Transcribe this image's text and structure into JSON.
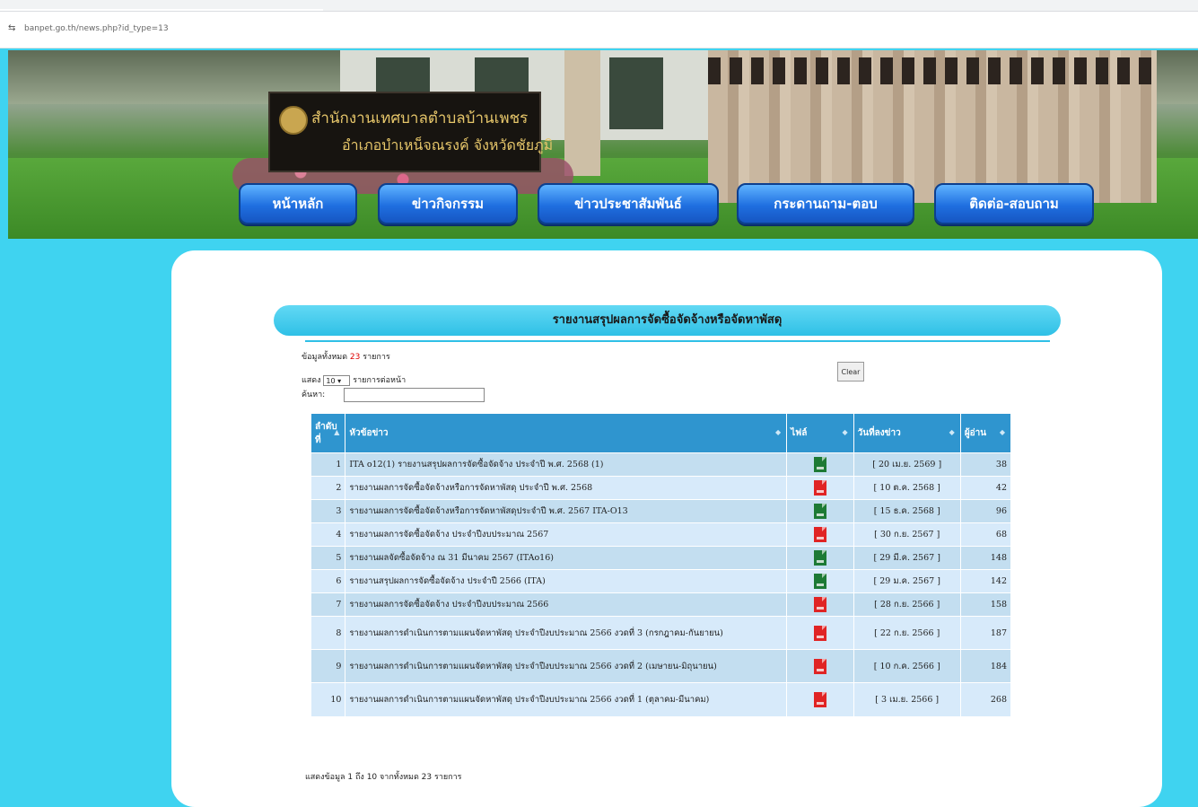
{
  "browser": {
    "url": "banpet.go.th/news.php?id_type=13"
  },
  "banner": {
    "sign_line1": "สำนักงานเทศบาลตำบลบ้านเพชร",
    "sign_line2": "อำเภอบำเหน็จณรงค์ จังหวัดชัยภูมิ"
  },
  "nav": [
    {
      "label": "หน้าหลัก"
    },
    {
      "label": "ข่าวกิจกรรม"
    },
    {
      "label": "ข่าวประชาสัมพันธ์"
    },
    {
      "label": "กระดานถาม-ตอบ"
    },
    {
      "label": "ติดต่อ-สอบถาม"
    }
  ],
  "page": {
    "title": "รายงานสรุปผลการจัดซื้อจัดจ้างหรือจัดหาพัสดุ",
    "total_prefix": "ข้อมูลทั้งหมด",
    "total_count": "23",
    "total_suffix": "รายการ",
    "show_prefix": "แสดง",
    "page_size": "10",
    "show_suffix": "รายการต่อหน้า",
    "search_label": "ค้นหา:",
    "search_value": "",
    "clear_label": "Clear",
    "footer": "แสดงข้อมูล 1 ถึง 10 จากทั้งหมด 23 รายการ"
  },
  "table": {
    "headers": [
      "ลำดับที่",
      "หัวข้อข่าว",
      "ไฟล์",
      "วันที่ลงข่าว",
      "ผู้อ่าน"
    ],
    "rows": [
      {
        "no": "1",
        "title": "ITA o12(1) รายงานสรุปผลการจัดซื้อจัดจ้าง ประจำปี พ.ศ. 2568 (1)",
        "file": "xls",
        "date": "[ 20 เม.ย. 2569 ]",
        "views": "38"
      },
      {
        "no": "2",
        "title": "รายงานผลการจัดซื้อจัดจ้างหรือการจัดหาพัสดุ ประจำปี พ.ศ. 2568",
        "file": "pdf",
        "date": "[ 10 ต.ค. 2568 ]",
        "views": "42"
      },
      {
        "no": "3",
        "title": "รายงานผลการจัดซื้อจัดจ้างหรือการจัดหาพัสดุประจำปี พ.ศ. 2567 ITA-O13",
        "file": "xls",
        "date": "[ 15 ธ.ค. 2568 ]",
        "views": "96"
      },
      {
        "no": "4",
        "title": "รายงานผลการจัดซื้อจัดจ้าง ประจำปีงบประมาณ 2567",
        "file": "pdf",
        "date": "[ 30 ก.ย. 2567 ]",
        "views": "68"
      },
      {
        "no": "5",
        "title": "รายงานผลจัดซื้อจัดจ้าง ณ 31 มีนาคม 2567 (ITAo16)",
        "file": "xls",
        "date": "[ 29 มี.ค. 2567 ]",
        "views": "148"
      },
      {
        "no": "6",
        "title": "รายงานสรุปผลการจัดซื้อจัดจ้าง ประจำปี 2566 (ITA)",
        "file": "xls",
        "date": "[ 29 ม.ค. 2567 ]",
        "views": "142"
      },
      {
        "no": "7",
        "title": "รายงานผลการจัดซื้อจัดจ้าง ประจำปีงบประมาณ 2566",
        "file": "pdf",
        "date": "[ 28 ก.ย. 2566 ]",
        "views": "158"
      },
      {
        "no": "8",
        "title": "รายงานผลการดำเนินการตามแผนจัดหาพัสดุ ประจำปีงบประมาณ 2566 งวดที่ 3 (กรกฎาคม-กันยายน)",
        "file": "pdf",
        "date": "[ 22 ก.ย. 2566 ]",
        "views": "187"
      },
      {
        "no": "9",
        "title": "รายงานผลการดำเนินการตามแผนจัดหาพัสดุ ประจำปีงบประมาณ 2566 งวดที่ 2 (เมษายน-มิถุนายน)",
        "file": "pdf",
        "date": "[ 10 ก.ค. 2566 ]",
        "views": "184"
      },
      {
        "no": "10",
        "title": "รายงานผลการดำเนินการตามแผนจัดหาพัสดุ ประจำปีงบประมาณ 2566 งวดที่ 1 (ตุลาคม-มีนาคม)",
        "file": "pdf",
        "date": "[ 3 เม.ย. 2566 ]",
        "views": "268"
      }
    ]
  },
  "colors": {
    "background": "#3fd3f0",
    "header_blue": "#2f95cf",
    "row_a": "#c3def0",
    "row_b": "#d7eafa",
    "nav_button": "#1f6fe0"
  }
}
